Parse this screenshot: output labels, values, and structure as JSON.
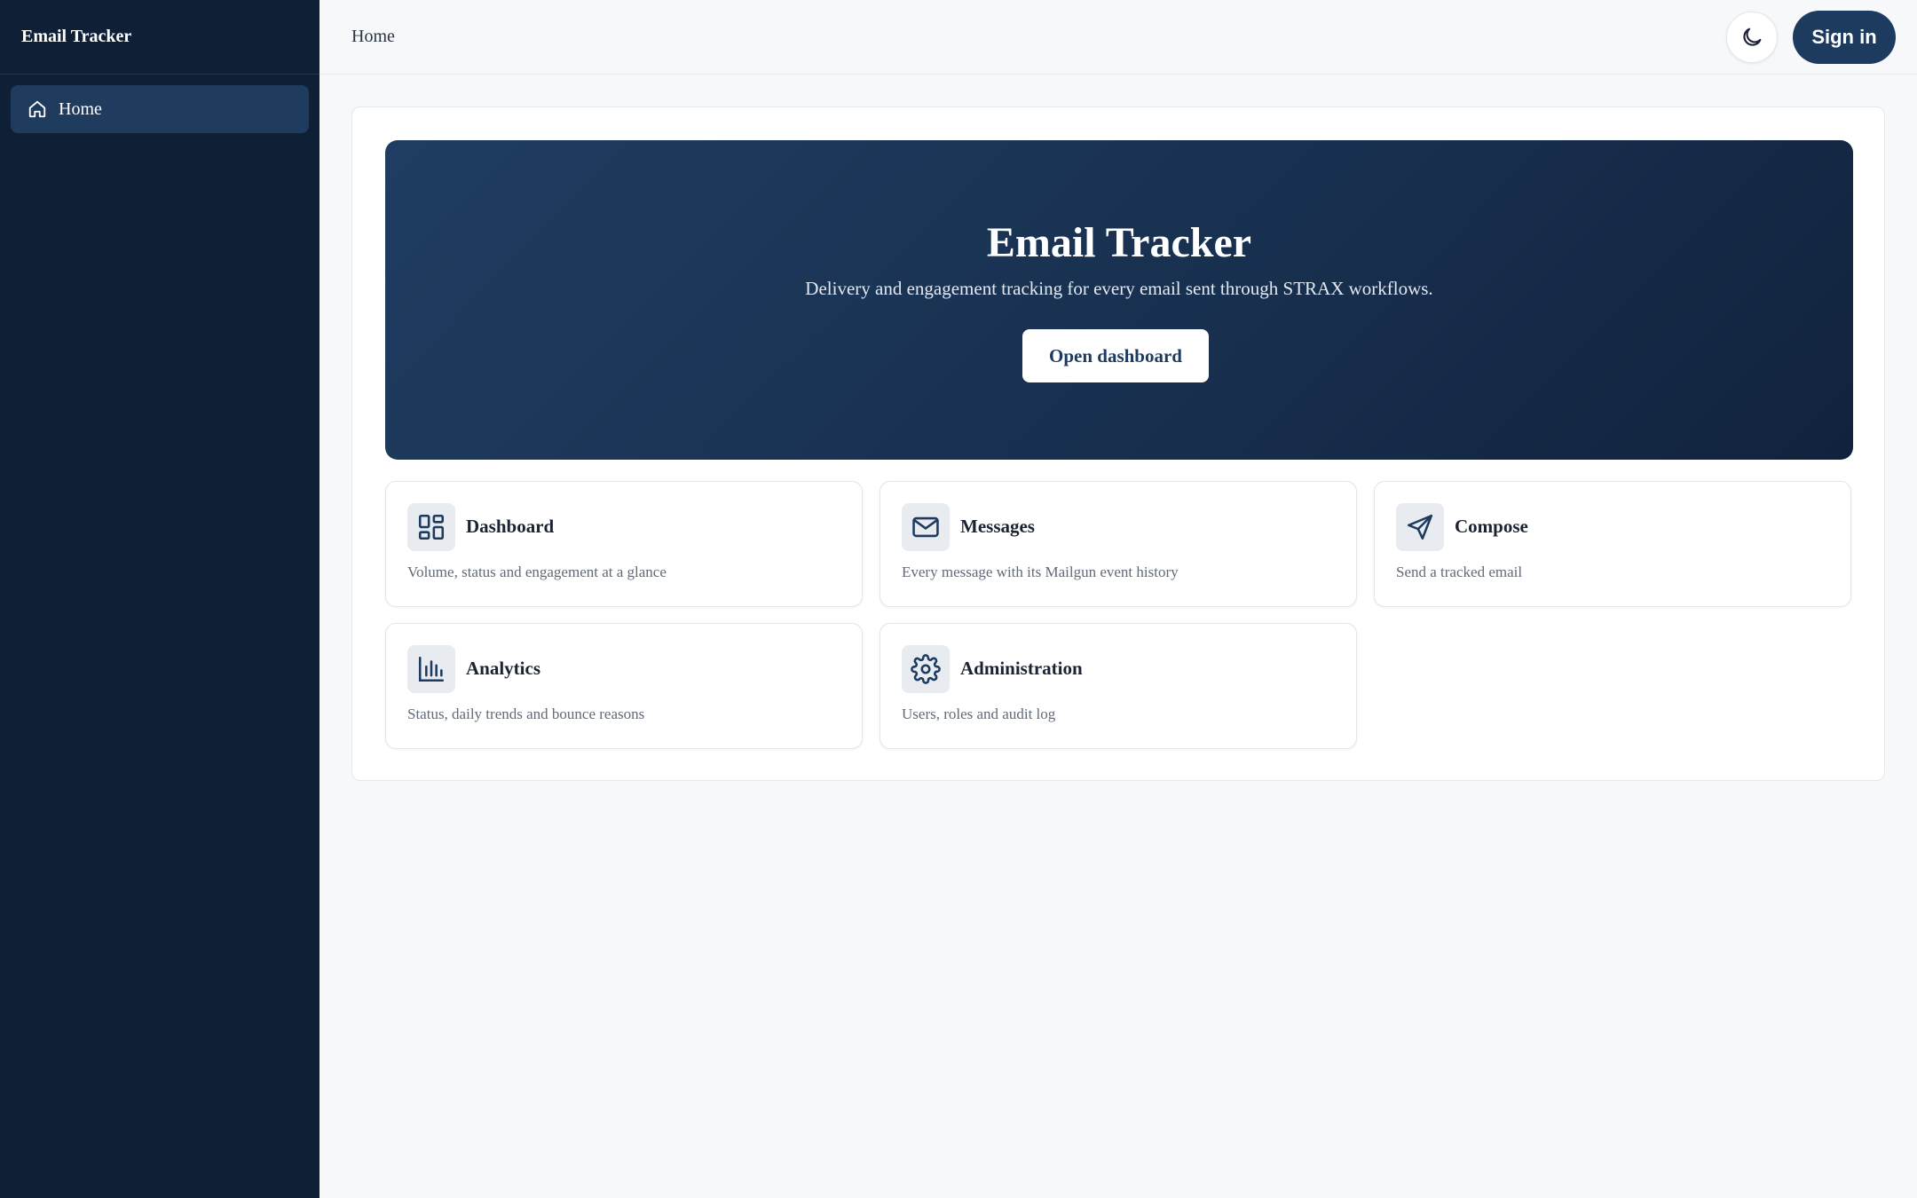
{
  "app": {
    "title": "Email Tracker"
  },
  "sidebar": {
    "items": [
      {
        "label": "Home",
        "icon": "home-icon",
        "active": true
      }
    ]
  },
  "header": {
    "breadcrumb": "Home",
    "theme_toggle_icon": "moon-icon",
    "signin_label": "Sign in"
  },
  "hero": {
    "title": "Email Tracker",
    "subtitle": "Delivery and engagement tracking for every email sent through STRAX workflows.",
    "button_label": "Open dashboard"
  },
  "tiles": [
    {
      "title": "Dashboard",
      "description": "Volume, status and engagement at a glance",
      "icon": "dashboard-icon"
    },
    {
      "title": "Messages",
      "description": "Every message with its Mailgun event history",
      "icon": "mail-icon"
    },
    {
      "title": "Compose",
      "description": "Send a tracked email",
      "icon": "send-icon"
    },
    {
      "title": "Analytics",
      "description": "Status, daily trends and bounce reasons",
      "icon": "bar-chart-icon"
    },
    {
      "title": "Administration",
      "description": "Users, roles and audit log",
      "icon": "gear-icon"
    }
  ],
  "colors": {
    "sidebar_bg": "#0f1f36",
    "sidebar_active": "#1f3b5e",
    "accent": "#1d3a5f",
    "page_bg": "#f7f8fa"
  }
}
